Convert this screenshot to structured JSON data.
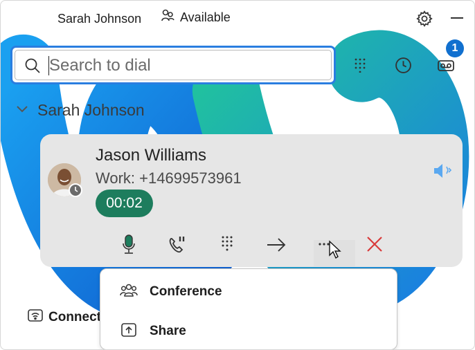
{
  "header": {
    "user_name": "Sarah Johnson",
    "status": "Available",
    "icons": {
      "logo": "webex-logo",
      "status": "presence-icon",
      "settings": "gear-icon",
      "minimize": "minimize-icon"
    }
  },
  "search": {
    "placeholder": "Search to dial",
    "value": ""
  },
  "toolbar": {
    "keypad": "keypad-icon",
    "history": "clock-icon",
    "voicemail": "voicemail-icon",
    "voicemail_badge": "1"
  },
  "section": {
    "title": "Sarah Johnson",
    "expanded": true
  },
  "call": {
    "name": "Jason Williams",
    "number": "Work: +14699573961",
    "duration": "00:02",
    "controls": [
      "microphone",
      "hold",
      "keypad",
      "transfer",
      "more",
      "end-call"
    ]
  },
  "connect": {
    "label": "Connect"
  },
  "menu": {
    "items": [
      {
        "label": "Conference",
        "icon": "people-icon"
      },
      {
        "label": "Share",
        "icon": "share-icon"
      }
    ]
  },
  "colors": {
    "accent": "#2a7ee0",
    "timer_bg": "#1d7d5d",
    "end_call": "#d93a3a",
    "badge": "#1170cf",
    "speaker": "#5aa8f0"
  }
}
